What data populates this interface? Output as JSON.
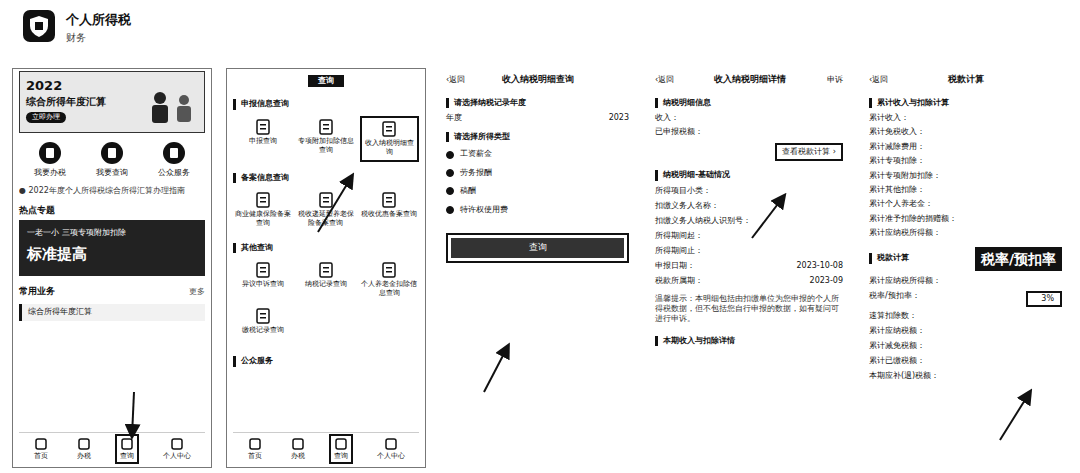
{
  "app": {
    "name": "个人所得税",
    "category": "财务"
  },
  "home": {
    "banner": {
      "year": "2022",
      "title": "综合所得年度汇算",
      "button": "立即办理"
    },
    "quick_actions": [
      "我要办税",
      "我要查询",
      "公众服务"
    ],
    "notice": "● 2022年度个人所得税综合所得汇算办理指南",
    "hot_title": "热点专题",
    "hot_banner": {
      "line1": "一老一小 三项专项附加扣除",
      "line2": "标准提高"
    },
    "common_title": "常用业务",
    "common_more": "更多",
    "common_items": [
      "综合所得年度汇算"
    ],
    "nav": [
      {
        "label": "首页",
        "selected": false
      },
      {
        "label": "办税",
        "selected": false
      },
      {
        "label": "查询",
        "selected": true
      },
      {
        "label": "个人中心",
        "selected": false
      }
    ]
  },
  "query": {
    "title": "查询",
    "sections": [
      {
        "title": "申报信息查询",
        "items": [
          {
            "label": "申报查询",
            "highlighted": false
          },
          {
            "label": "专项附加扣除信息查询",
            "highlighted": false
          },
          {
            "label": "收入纳税明细查询",
            "highlighted": true
          }
        ]
      },
      {
        "title": "备案信息查询",
        "items": [
          {
            "label": "商业健康保险备案查询",
            "highlighted": false
          },
          {
            "label": "税收递延型养老保险备案查询",
            "highlighted": false
          },
          {
            "label": "税收优惠备案查询",
            "highlighted": false
          }
        ]
      },
      {
        "title": "其他查询",
        "items": [
          {
            "label": "异议申诉查询",
            "highlighted": false
          },
          {
            "label": "纳税记录查询",
            "highlighted": false
          },
          {
            "label": "个人养老金扣除信息查询",
            "highlighted": false
          },
          {
            "label": "缴税记录查询",
            "highlighted": false
          }
        ]
      },
      {
        "title": "公众服务",
        "items": []
      }
    ],
    "nav": [
      {
        "label": "首页",
        "selected": false
      },
      {
        "label": "办税",
        "selected": false
      },
      {
        "label": "查询",
        "selected": true
      },
      {
        "label": "个人中心",
        "selected": false
      }
    ]
  },
  "tax_query": {
    "back_icon": "‹",
    "back": "返回",
    "title": "收入纳税明细查询",
    "year_section": "请选择纳税记录年度",
    "year_label": "年度",
    "year_value": "2023",
    "type_section": "请选择所得类型",
    "types": [
      {
        "label": "工资薪金",
        "checked": true
      },
      {
        "label": "劳务报酬",
        "checked": true
      },
      {
        "label": "稿酬",
        "checked": true
      },
      {
        "label": "特许权使用费",
        "checked": true
      }
    ],
    "button": "查询"
  },
  "detail": {
    "back_icon": "‹",
    "back": "返回",
    "title": "收入纳税明细详情",
    "action": "申诉",
    "info_title": "纳税明细信息",
    "info_rows": [
      "收入：",
      "已申报税额："
    ],
    "button": "查看税款计算",
    "basic_title": "纳税明细-基础情况",
    "basic_rows": [
      {
        "label": "所得项目小类：",
        "value": ""
      },
      {
        "label": "扣缴义务人名称：",
        "value": ""
      },
      {
        "label": "扣缴义务人纳税人识别号：",
        "value": ""
      },
      {
        "label": "所得期间起：",
        "value": ""
      },
      {
        "label": "所得期间止：",
        "value": ""
      },
      {
        "label": "申报日期：",
        "value": "2023-10-08"
      },
      {
        "label": "税款所属期：",
        "value": "2023-09"
      }
    ],
    "tip": "温馨提示：本明细包括由扣缴单位为您申报的个人所得税数据，但不包括您自行申报的数据，如有疑问可进行申诉。",
    "income_title": "本期收入与扣除详情"
  },
  "calc": {
    "back_icon": "‹",
    "back": "返回",
    "title": "税款计算",
    "sum_title": "累计收入与扣除计算",
    "sum_rows": [
      "累计收入：",
      "累计免税收入：",
      "累计减除费用：",
      "累计专项扣除：",
      "累计专项附加扣除：",
      "累计其他扣除：",
      "累计个人养老金：",
      "累计准予扣除的捐赠额：",
      "累计应纳税所得额："
    ],
    "tax_title": "税款计算",
    "callout": "税率/预扣率",
    "tax_rows": [
      {
        "label": "累计应纳税所得额：",
        "value": "",
        "highlighted": false
      },
      {
        "label": "税率/预扣率：",
        "value": "3%",
        "highlighted": true
      },
      {
        "label": "速算扣除数：",
        "value": "",
        "highlighted": false
      },
      {
        "label": "累计应纳税额：",
        "value": "",
        "highlighted": false
      },
      {
        "label": "累计减免税额：",
        "value": "",
        "highlighted": false
      },
      {
        "label": "累计已缴税额：",
        "value": "",
        "highlighted": false
      },
      {
        "label": "本期应补(退)税额：",
        "value": "",
        "highlighted": false
      }
    ]
  }
}
